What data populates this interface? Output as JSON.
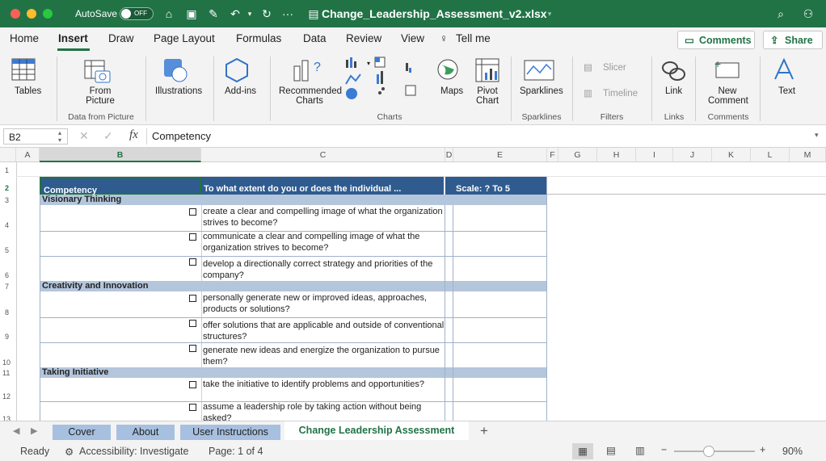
{
  "titlebar": {
    "autosave_label": "AutoSave",
    "autosave_state": "OFF",
    "file_title": "Change_Leadership_Assessment_v2.xlsx",
    "more": "···"
  },
  "menu": {
    "tabs": [
      "Home",
      "Insert",
      "Draw",
      "Page Layout",
      "Formulas",
      "Data",
      "Review",
      "View",
      "Tell me"
    ],
    "comments_label": "Comments",
    "share_label": "Share"
  },
  "ribbon": {
    "tables": "Tables",
    "from_picture": "From Picture",
    "illustrations": "Illustrations",
    "addins": "Add-ins",
    "recommended_charts": "Recommended Charts",
    "maps": "Maps",
    "pivot_chart": "Pivot Chart",
    "sparklines": "Sparklines",
    "slicer": "Slicer",
    "timeline": "Timeline",
    "link": "Link",
    "new_comment": "New Comment",
    "text": "Text",
    "groups": {
      "data_from_picture": "Data from Picture",
      "charts": "Charts",
      "sparklines": "Sparklines",
      "filters": "Filters",
      "links": "Links",
      "comments": "Comments"
    }
  },
  "formula_bar": {
    "name_box": "B2",
    "fx": "fx",
    "formula": "Competency"
  },
  "grid": {
    "columns": [
      "A",
      "B",
      "C",
      "D",
      "E",
      "F",
      "G",
      "H",
      "I",
      "J",
      "K",
      "L",
      "M"
    ],
    "rows": [
      "1",
      "2",
      "3",
      "4",
      "5",
      "6",
      "7",
      "8",
      "9",
      "10",
      "11",
      "12",
      "13"
    ],
    "header": {
      "competency": "Competency",
      "question": "To what extent do you or does the individual ...",
      "scale": "Scale: ? To 5"
    },
    "sections": [
      "Visionary Thinking",
      "Creativity and Innovation",
      "Taking Initiative"
    ],
    "questions": [
      "create a clear and compelling image of what the organization strives to become?",
      "communicate a clear and compelling image of what the organization strives to become?",
      "develop a directionally correct strategy and priorities of the company?",
      "personally generate new or improved ideas, approaches, products or solutions?",
      "offer solutions that are applicable and outside of conventional structures?",
      "generate new ideas and energize the organization to pursue them?",
      "take the initiative to identify problems and opportunities?",
      "assume a leadership role by taking action without being asked?"
    ]
  },
  "sheet_tabs": [
    "Cover",
    "About",
    "User Instructions",
    "Change Leadership Assessment"
  ],
  "add_sheet": "+",
  "status": {
    "ready": "Ready",
    "accessibility": "Accessibility: Investigate",
    "page": "Page: 1 of 4",
    "zoom": "90%",
    "zoom_level": 0.9
  },
  "colors": {
    "title_green": "#217346",
    "header_blue": "#2f5b8f",
    "section_blue": "#b4c6dc",
    "tab_blue": "#a7c0e0"
  }
}
